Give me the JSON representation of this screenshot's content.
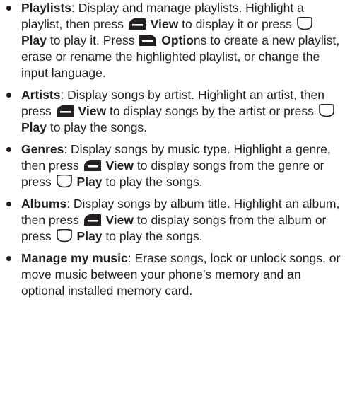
{
  "items": [
    {
      "title": "Playlists",
      "s1": ": Display and manage playlists. Highlight a playlist, then press ",
      "k1": "View",
      "s2": " to display it or press ",
      "k2": "Play",
      "s3": " to play it. Press ",
      "k3": "Optio",
      "s4": "ns to create a new playlist, erase or rename the highlighted playlist, or change the input language."
    },
    {
      "title": "Artists",
      "s1": ": Display songs by artist. Highlight an artist, then press ",
      "k1": "View",
      "s2": " to display songs by the artist or press ",
      "k2": "Play",
      "s3": " to play the songs."
    },
    {
      "title": "Genres",
      "s1": ": Display songs by music type. Highlight a genre, then press ",
      "k1": "View",
      "s2": " to display songs from the genre or press ",
      "k2": "Play",
      "s3": " to play the songs."
    },
    {
      "title": "Albums",
      "s1": ": Display songs by album title. Highlight an album, then press ",
      "k1": "View",
      "s2": " to display songs from the album or press ",
      "k2": "Play",
      "s3": " to play the songs."
    },
    {
      "title": "Manage my music",
      "s1": ": Erase songs, lock or unlock songs, or move music between your phone’s memory and an optional installed memory card."
    }
  ],
  "icons": {
    "left_softkey": "left-softkey-icon",
    "center_key": "center-key-icon",
    "right_softkey": "right-softkey-icon"
  },
  "colors": {
    "text": "#231f20",
    "key_fill": "#231f20",
    "key_outline": "#231f20",
    "key_light": "#ffffff"
  }
}
